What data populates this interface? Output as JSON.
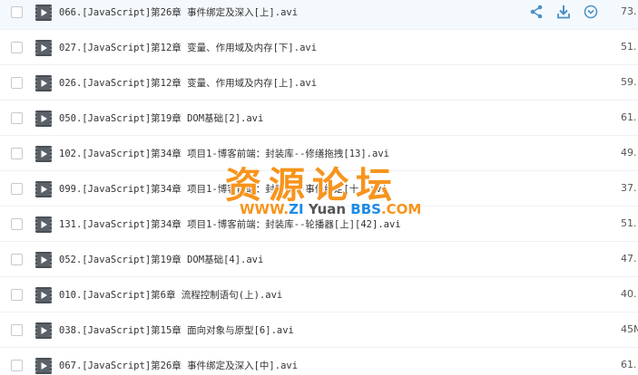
{
  "colors": {
    "icon_blue": "#4a90c8",
    "video_icon_dark": "#4a4f56",
    "watermark_orange": "#f7941d",
    "watermark_blue": "#1e8be6"
  },
  "row_actions": {
    "share_icon": "share-icon",
    "download_icon": "download-icon",
    "more_icon": "chevron-down-circle-icon"
  },
  "files": [
    {
      "name": "066.[JavaScript]第26章 事件绑定及深入[上].avi",
      "size": "73."
    },
    {
      "name": "027.[JavaScript]第12章 变量、作用域及内存[下].avi",
      "size": "51."
    },
    {
      "name": "026.[JavaScript]第12章 变量、作用域及内存[上].avi",
      "size": "59."
    },
    {
      "name": "050.[JavaScript]第19章 DOM基础[2].avi",
      "size": "61."
    },
    {
      "name": "102.[JavaScript]第34章 项目1-博客前端：封装库--修缮拖拽[13].avi",
      "size": "49."
    },
    {
      "name": "099.[JavaScript]第34章 项目1-博客前端：封装库--事件绑定[十].avi",
      "size": "37."
    },
    {
      "name": "131.[JavaScript]第34章 项目1-博客前端：封装库--轮播器[上][42].avi",
      "size": "51."
    },
    {
      "name": "052.[JavaScript]第19章 DOM基础[4].avi",
      "size": "47."
    },
    {
      "name": "010.[JavaScript]第6章 流程控制语句(上).avi",
      "size": "40."
    },
    {
      "name": "038.[JavaScript]第15章 面向对象与原型[6].avi",
      "size": "45M"
    },
    {
      "name": "067.[JavaScript]第26章 事件绑定及深入[中].avi",
      "size": "61."
    }
  ],
  "watermark": {
    "title": "资源论坛",
    "url_www": "WWW.",
    "url_zi": "ZI",
    "url_yuan": " Yuan ",
    "url_bbs": "BBS",
    "url_com": ".COM"
  }
}
